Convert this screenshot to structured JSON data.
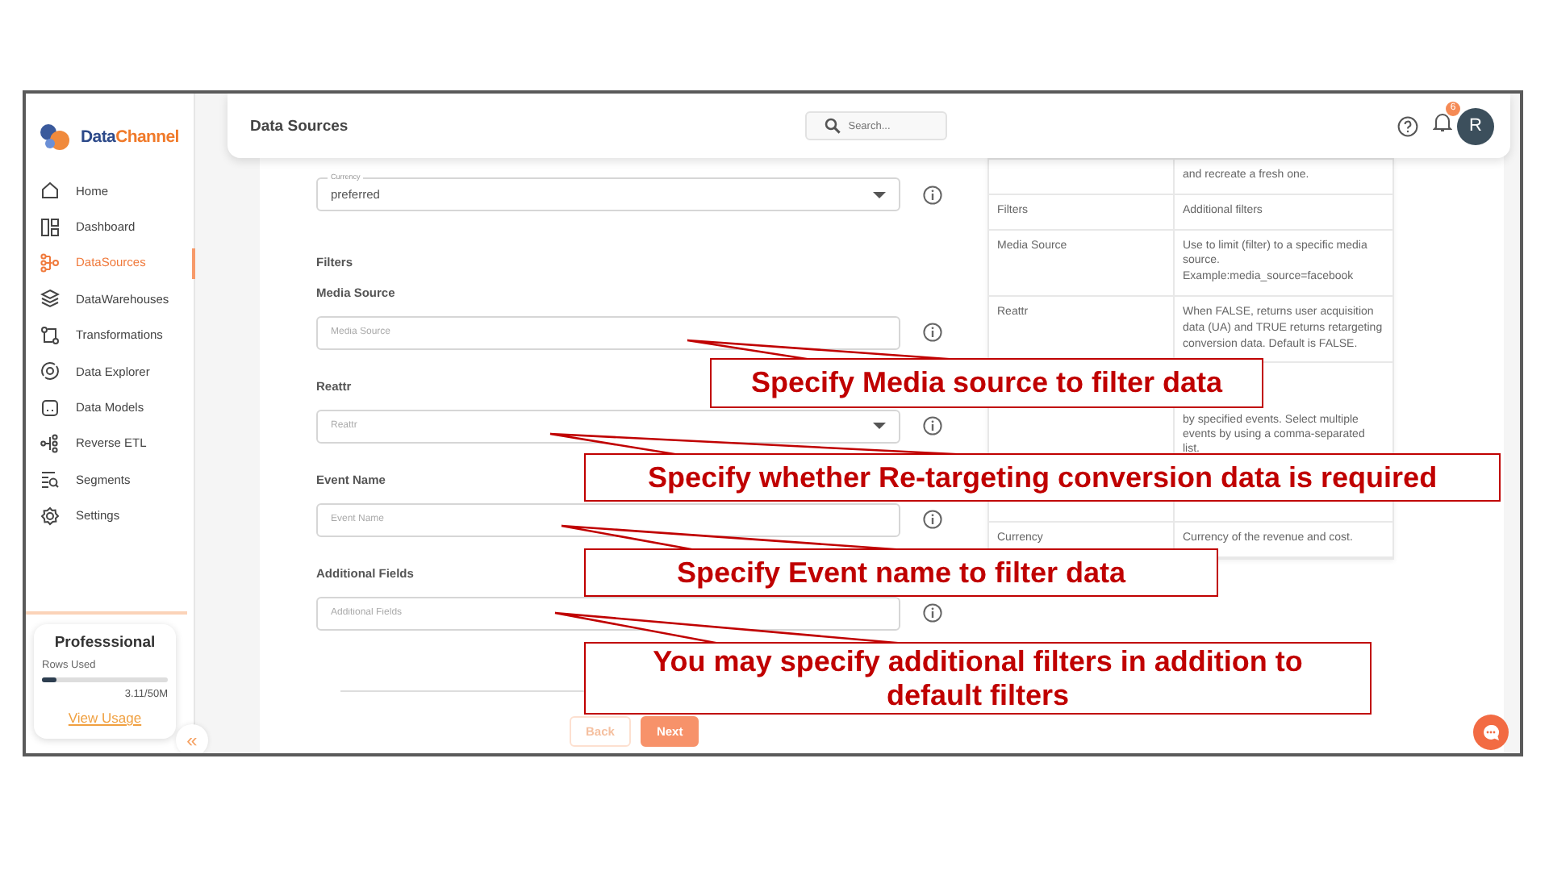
{
  "logo": {
    "dark": "Data",
    "accent": "Channel"
  },
  "sidebar": {
    "items": [
      {
        "label": "Home",
        "selected": false
      },
      {
        "label": "Dashboard",
        "selected": false
      },
      {
        "label": "DataSources",
        "selected": true
      },
      {
        "label": "DataWarehouses",
        "selected": false
      },
      {
        "label": "Transformations",
        "selected": false
      },
      {
        "label": "Data Explorer",
        "selected": false
      },
      {
        "label": "Data Models",
        "selected": false
      },
      {
        "label": "Reverse ETL",
        "selected": false
      },
      {
        "label": "Segments",
        "selected": false
      },
      {
        "label": "Settings",
        "selected": false
      }
    ],
    "plan": {
      "name": "Professsional",
      "usage_label": "Rows Used",
      "level": 0.12,
      "usage": "3.11/50M",
      "link": "View Usage"
    },
    "collapse": "«"
  },
  "header": {
    "title": "Data Sources",
    "search": {
      "placeholder": "Search..."
    },
    "notifications": "6",
    "avatar": "R"
  },
  "form": {
    "currency": {
      "label": "Currency",
      "value": "preferred"
    },
    "section": "Filters",
    "fields": [
      {
        "label": "Media Source",
        "placeholder": "Media Source",
        "kind": "text"
      },
      {
        "label": "Reattr",
        "placeholder": "Reattr",
        "kind": "select"
      },
      {
        "label": "Event Name",
        "placeholder": "Event Name",
        "kind": "text"
      },
      {
        "label": "Additional Fields",
        "placeholder": "Additional Fields",
        "kind": "text"
      }
    ],
    "buttons": [
      {
        "label": "Back",
        "primary": false
      },
      {
        "label": "Next",
        "primary": true
      }
    ]
  },
  "table": {
    "rows": [
      {
        "column_2": "and recreate a fresh one."
      },
      {
        "column_1": "Filters",
        "column_2": "Additional filters"
      },
      {
        "column_1": "Media Source",
        "column_2": "Use to limit (filter) to a specific media source. Example:media_source=facebook"
      },
      {
        "column_1": "Reattr",
        "column_2": "When FALSE, returns user acquisition data (UA) and TRUE returns retargeting conversion data. Default is FALSE."
      },
      {
        "column_2": "by specified events. Select multiple events by using a comma-separated list."
      },
      {
        "column_1": "Currency",
        "column_2": "Currency of the revenue and cost."
      }
    ]
  },
  "callouts": [
    {
      "text": "Specify Media source to filter data"
    },
    {
      "text": "Specify whether Re-targeting conversion data is required"
    },
    {
      "text": "Specify Event name to filter data"
    },
    {
      "text": "You may specify additional filters in addition to default filters"
    }
  ]
}
